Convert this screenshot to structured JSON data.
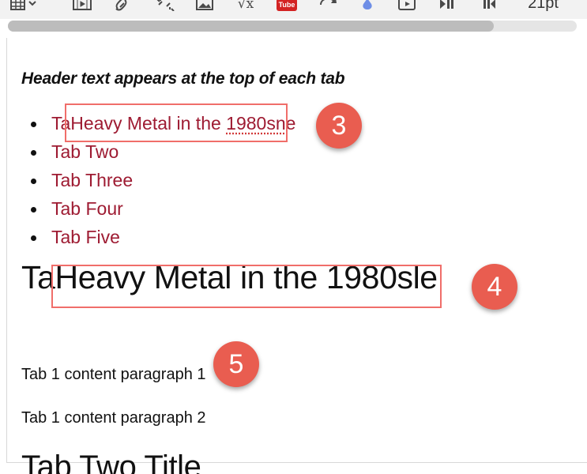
{
  "toolbar": {
    "font_size": "21pt",
    "youtube_label": "Tube",
    "icons": [
      "table-icon",
      "media-icon",
      "link-icon",
      "unlink-icon",
      "image-icon",
      "equation-icon",
      "youtube-icon",
      "embed-icon",
      "drop-icon",
      "video-icon",
      "play-pause-icon",
      "ltr-icon"
    ]
  },
  "editor": {
    "header_text": "Header text appears at the top of each tab",
    "tabs": [
      {
        "prefix": "Ta",
        "main": "Heavy Metal in the ",
        "misspelled": "1980sn",
        "suffix": "e"
      },
      {
        "label": "Tab Two"
      },
      {
        "label": "Tab Three"
      },
      {
        "label": "Tab Four"
      },
      {
        "label": "Tab Five"
      }
    ],
    "heading_one": {
      "prefix": "Ta",
      "main": "Heavy Metal in the 1980s",
      "suffix": "le"
    },
    "paragraphs": [
      "Tab 1 content paragraph 1",
      "Tab 1 content paragraph 2"
    ],
    "heading_two": "Tab Two Title"
  },
  "annotations": {
    "badges": [
      "3",
      "4",
      "5"
    ],
    "highlight_color": "#f06e6a",
    "badge_color": "#e95d50"
  },
  "colors": {
    "link": "#9e1b32",
    "text": "#111111",
    "toolbar_background": "#f2f2f2"
  }
}
